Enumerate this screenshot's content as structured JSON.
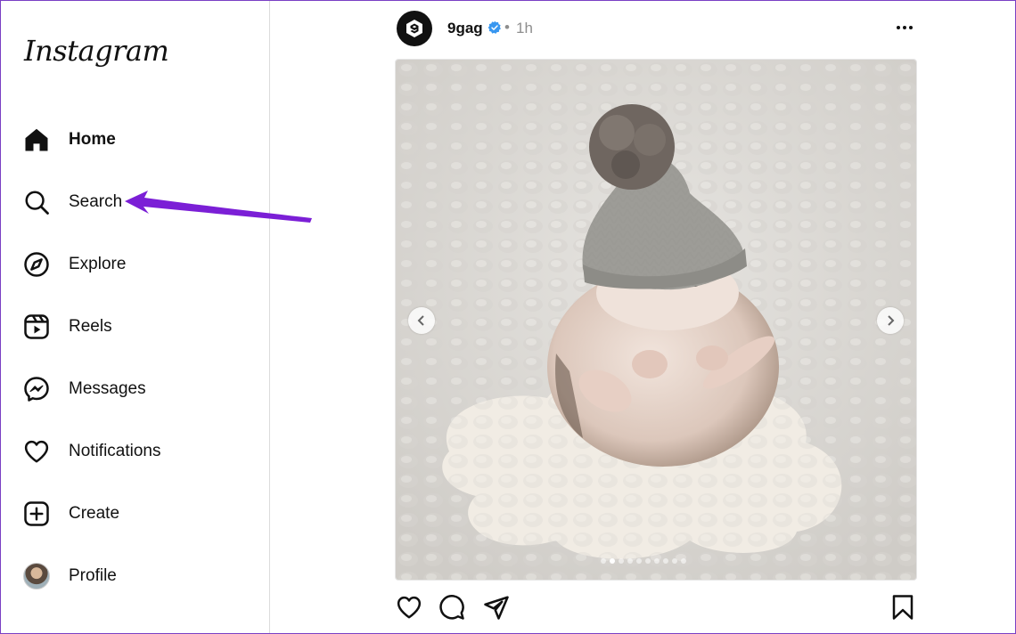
{
  "app": {
    "logo": "Instagram"
  },
  "sidebar": {
    "items": [
      {
        "label": "Home",
        "icon": "home-icon"
      },
      {
        "label": "Search",
        "icon": "search-icon"
      },
      {
        "label": "Explore",
        "icon": "compass-icon"
      },
      {
        "label": "Reels",
        "icon": "reels-icon"
      },
      {
        "label": "Messages",
        "icon": "messenger-icon"
      },
      {
        "label": "Notifications",
        "icon": "heart-icon"
      },
      {
        "label": "Create",
        "icon": "plus-square-icon"
      },
      {
        "label": "Profile",
        "icon": "avatar"
      }
    ]
  },
  "post": {
    "username": "9gag",
    "separator": "•",
    "time": "1h",
    "verified_color": "#3897f0",
    "carousel": {
      "total_slides": 10,
      "current_slide": 2
    },
    "actions": [
      "heart-icon",
      "comment-icon",
      "share-icon",
      "bookmark-icon"
    ]
  },
  "annotation": {
    "arrow_color": "#7b1fd6"
  }
}
